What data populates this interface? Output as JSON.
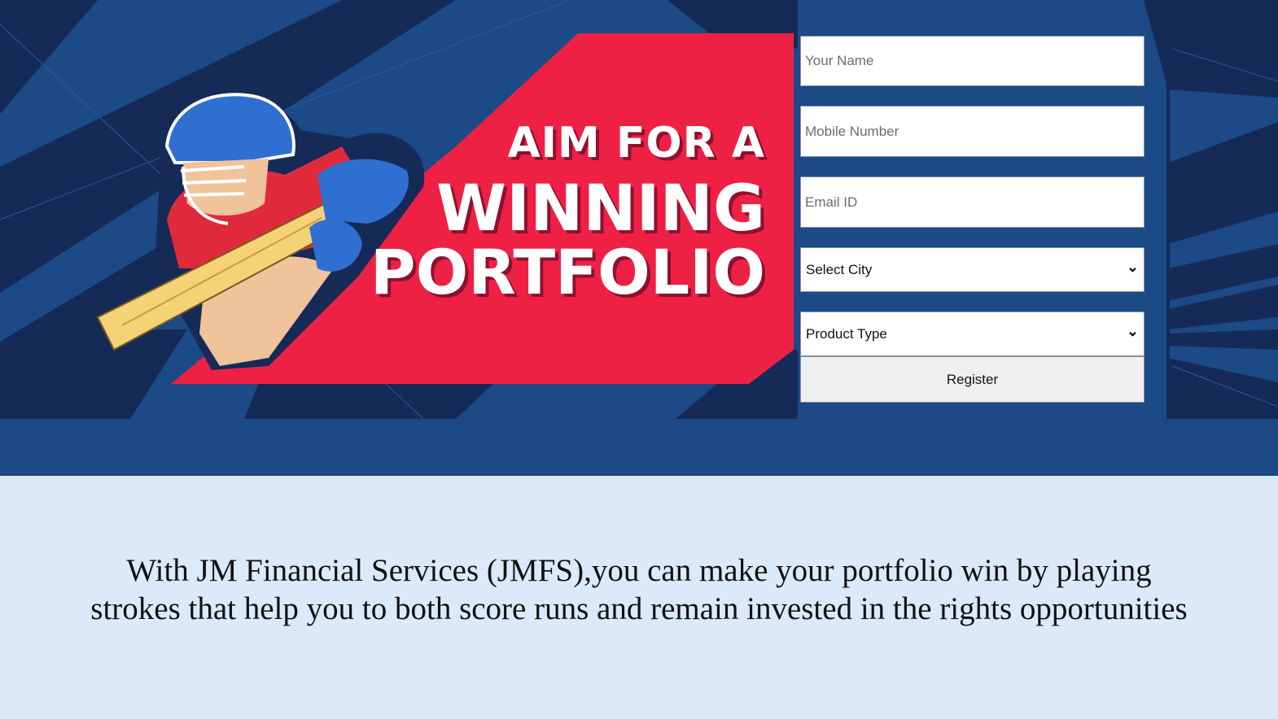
{
  "banner": {
    "headline_line1": "AIM FOR A",
    "headline_line2": "WINNING",
    "headline_line3": "PORTFOLIO",
    "illustration": "cricket-batsman-illustration"
  },
  "form": {
    "name_placeholder": "Your Name",
    "mobile_placeholder": "Mobile Number",
    "email_placeholder": "Email ID",
    "city_selected": "Select City",
    "product_selected": "Product Type",
    "register_label": "Register"
  },
  "content": {
    "tagline": "With JM Financial Services (JMFS),you can make your portfolio win by playing strokes that help you to both score runs and remain invested in the rights opportunities"
  },
  "colors": {
    "hero_blue": "#1b4a86",
    "navy": "#162a58",
    "banner_red": "#ee2145",
    "page_bg": "#dce9fb"
  }
}
